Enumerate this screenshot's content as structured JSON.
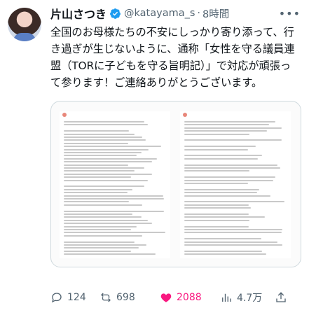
{
  "tweet": {
    "display_name": "片山さつき",
    "handle": "@katayama_s",
    "separator": "·",
    "time": "8時間",
    "more_icon": "more-horizontal-icon",
    "text": "全国のお母様たちの不安にしっかり寄り添って、行き過ぎが生じないように、通称「女性を守る議員連盟（TORに子どもを守る旨明記）」で対応が頑張って参ります！ご連絡ありがとうございます。"
  },
  "stats": {
    "replies": "124",
    "retweets": "698",
    "likes": "2088",
    "views": "4.7万"
  },
  "colors": {
    "like": "#f91880",
    "verified": "#1d9bf0",
    "muted": "#536471"
  }
}
